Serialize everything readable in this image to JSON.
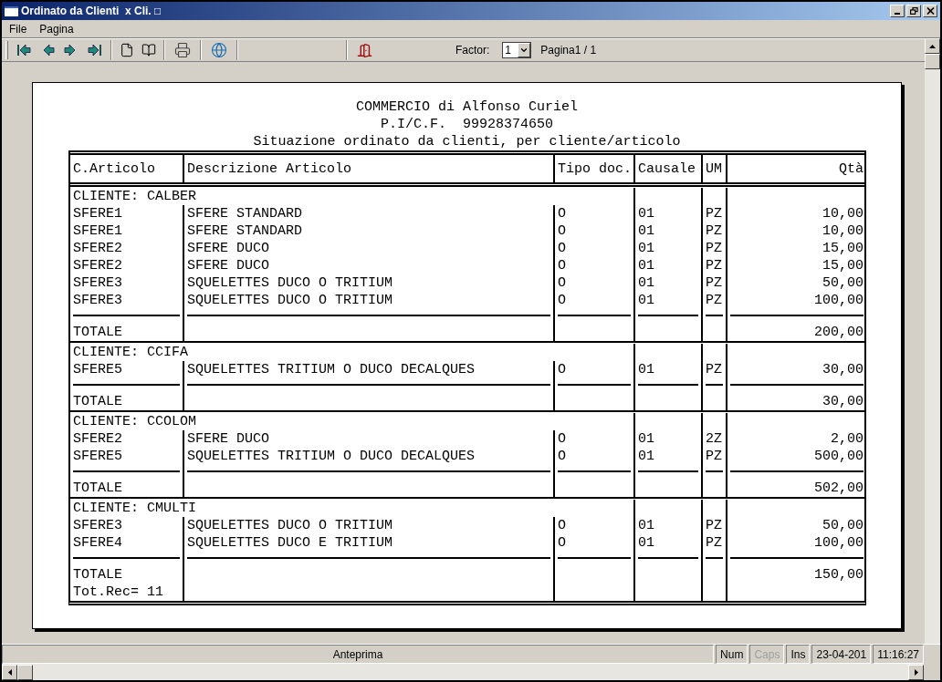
{
  "window": {
    "title": "Ordinato da Clienti  x Cli. □"
  },
  "menu": [
    "File",
    "Pagina"
  ],
  "toolbar": {
    "factor_label": "Factor:",
    "factor_value": "1",
    "page_label": "Pagina1 / 1"
  },
  "report": {
    "header_lines": [
      "COMMERCIO di Alfonso Curiel",
      "P.I/C.F.  99928374650",
      "Situazione ordinato da clienti, per cliente/articolo"
    ],
    "columns": [
      "C.Articolo",
      "Descrizione Articolo",
      "Tipo doc.",
      "Causale",
      "UM",
      "Qtà"
    ],
    "groups": [
      {
        "client": "CLIENTE: CALBER",
        "rows": [
          {
            "code": "SFERE1",
            "description": "SFERE STANDARD",
            "tipo": "O",
            "causale": "01",
            "um": "PZ",
            "qty": "10,00"
          },
          {
            "code": "SFERE1",
            "description": "SFERE STANDARD",
            "tipo": "O",
            "causale": "01",
            "um": "PZ",
            "qty": "10,00"
          },
          {
            "code": "SFERE2",
            "description": "SFERE DUCO",
            "tipo": "O",
            "causale": "01",
            "um": "PZ",
            "qty": "15,00"
          },
          {
            "code": "SFERE2",
            "description": "SFERE DUCO",
            "tipo": "O",
            "causale": "01",
            "um": "PZ",
            "qty": "15,00"
          },
          {
            "code": "SFERE3",
            "description": "SQUELETTES DUCO O TRITIUM",
            "tipo": "O",
            "causale": "01",
            "um": "PZ",
            "qty": "50,00"
          },
          {
            "code": "SFERE3",
            "description": "SQUELETTES DUCO O TRITIUM",
            "tipo": "O",
            "causale": "01",
            "um": "PZ",
            "qty": "100,00"
          }
        ],
        "total_label": "TOTALE",
        "total": "200,00"
      },
      {
        "client": "CLIENTE: CCIFA",
        "rows": [
          {
            "code": "SFERE5",
            "description": "SQUELETTES TRITIUM O DUCO DECALQUES",
            "tipo": "O",
            "causale": "01",
            "um": "PZ",
            "qty": "30,00"
          }
        ],
        "total_label": "TOTALE",
        "total": "30,00"
      },
      {
        "client": "CLIENTE: CCOLOM",
        "rows": [
          {
            "code": "SFERE2",
            "description": "SFERE DUCO",
            "tipo": "O",
            "causale": "01",
            "um": "2Z",
            "qty": "2,00"
          },
          {
            "code": "SFERE5",
            "description": "SQUELETTES TRITIUM O DUCO DECALQUES",
            "tipo": "O",
            "causale": "01",
            "um": "PZ",
            "qty": "500,00"
          }
        ],
        "total_label": "TOTALE",
        "total": "502,00"
      },
      {
        "client": "CLIENTE: CMULTI",
        "rows": [
          {
            "code": "SFERE3",
            "description": "SQUELETTES DUCO O TRITIUM",
            "tipo": "O",
            "causale": "01",
            "um": "PZ",
            "qty": "50,00"
          },
          {
            "code": "SFERE4",
            "description": "SQUELETTES DUCO E TRITIUM",
            "tipo": "O",
            "causale": "01",
            "um": "PZ",
            "qty": "100,00"
          }
        ],
        "total_label": "TOTALE",
        "total": "150,00"
      }
    ],
    "record_count": "Tot.Rec= 11"
  },
  "status_bar": [
    {
      "text": "Anteprima",
      "kind": "message",
      "disabled": false
    },
    {
      "text": "Num",
      "kind": "indicator",
      "disabled": false
    },
    {
      "text": "Caps",
      "kind": "indicator",
      "disabled": true
    },
    {
      "text": "Ins",
      "kind": "indicator",
      "disabled": false
    },
    {
      "text": "23-04-201",
      "kind": "indicator",
      "disabled": false
    },
    {
      "text": "11:16:27",
      "kind": "indicator",
      "disabled": false
    }
  ]
}
